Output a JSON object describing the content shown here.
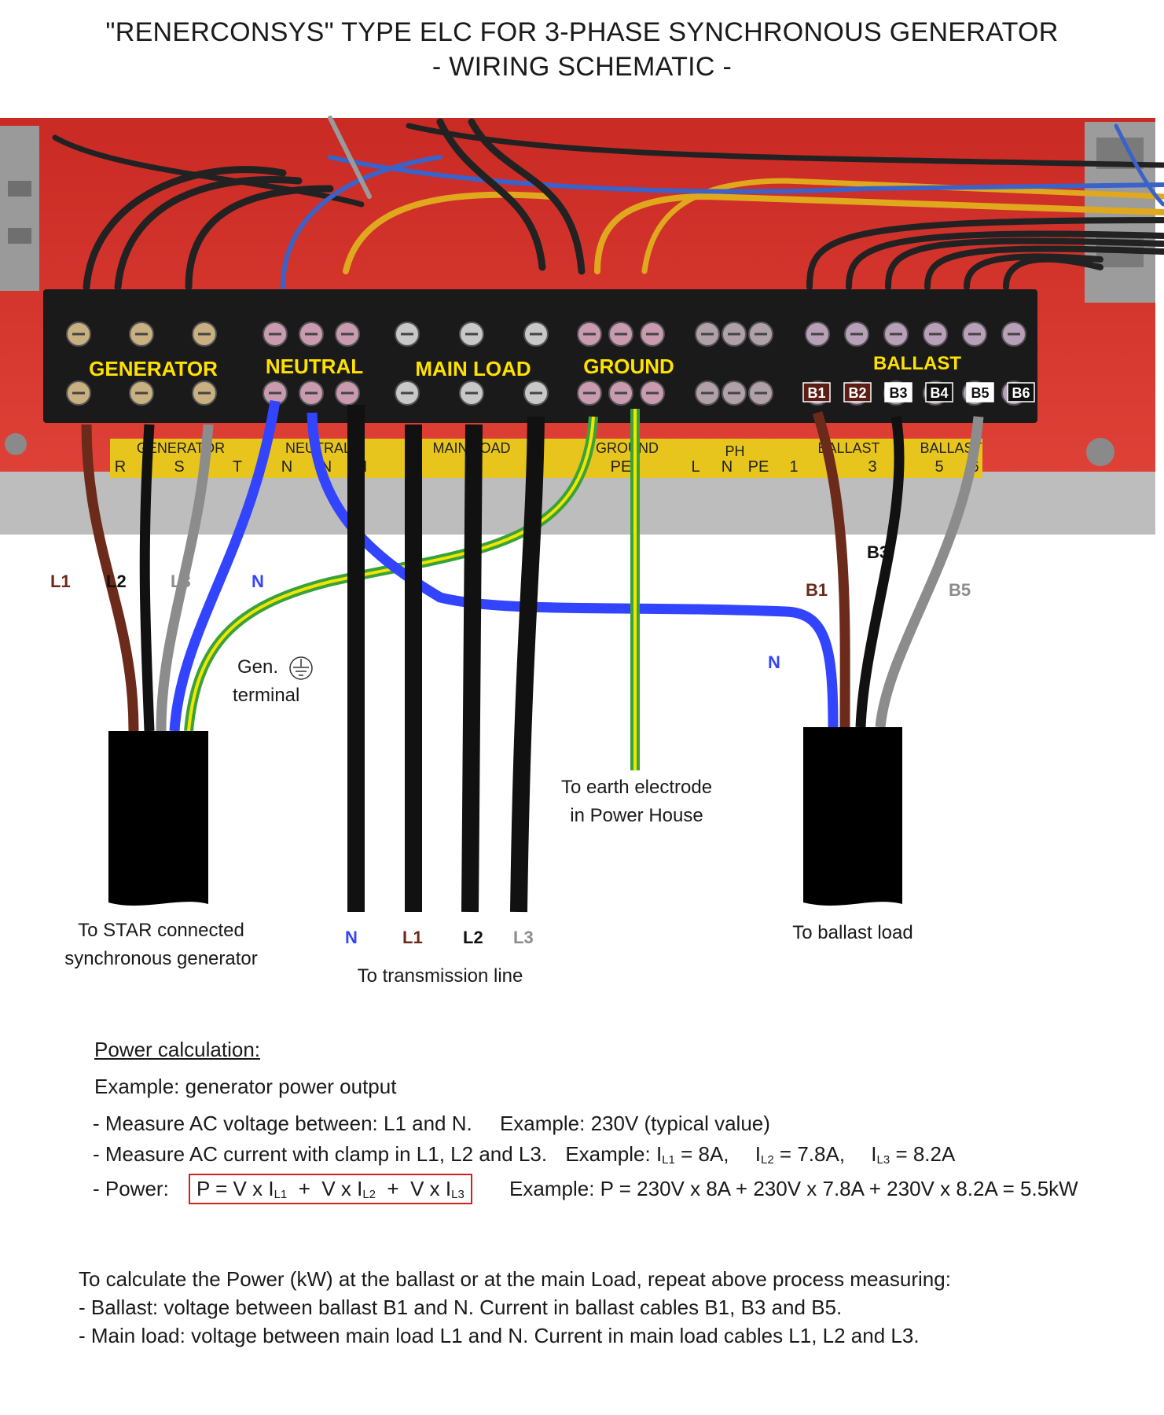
{
  "title": {
    "line1": "\"RENERCONSYS\" TYPE ELC FOR 3-PHASE SYNCHRONOUS GENERATOR",
    "line2": "- WIRING SCHEMATIC -"
  },
  "panel": {
    "sections": [
      "GENERATOR",
      "NEUTRAL",
      "MAIN LOAD",
      "GROUND",
      "BALLAST"
    ],
    "ballast_terminals": [
      "B1",
      "B2",
      "B3",
      "B4",
      "B5",
      "B6"
    ],
    "rail_labels": {
      "generator": "GENERATOR",
      "generator_terms": [
        "R",
        "S",
        "T"
      ],
      "neutral": "NEUTRAL",
      "neutral_terms": [
        "N",
        "N",
        "N"
      ],
      "main_load": "MAIN LOAD",
      "ground": "GROUND",
      "ground_term": "PE",
      "ph": "PH",
      "ph_terms": [
        "L",
        "N",
        "PE",
        "1"
      ],
      "ballast": "BALLAST",
      "ballast_terms": [
        "3",
        "5",
        "6"
      ]
    }
  },
  "wires": {
    "generator": [
      "L1",
      "L2",
      "L3",
      "N"
    ],
    "ballast": [
      "B1",
      "B3",
      "B5"
    ],
    "ballast_neutral": "N",
    "transmission": [
      "N",
      "L1",
      "L2",
      "L3"
    ]
  },
  "colors": {
    "brown": "#6b2a1a",
    "black": "#111111",
    "grey": "#8c8c8c",
    "blue": "#3344ff",
    "earth_green": "#3aa23a",
    "earth_yellow": "#f2e600",
    "panel_red": "#d8302a",
    "label_yellow": "#ffe100",
    "formula_box": "#d42020"
  },
  "labels": {
    "gen_terminal": [
      "Gen.",
      "terminal"
    ],
    "earth_electrode": [
      "To earth electrode",
      "in Power House"
    ],
    "generator_dest": [
      "To STAR connected",
      "synchronous generator"
    ],
    "transmission_dest": "To transmission line",
    "ballast_dest": "To ballast load"
  },
  "calculation": {
    "heading": "Power calculation:",
    "example_intro": "Example: generator power output",
    "voltage_line": "- Measure AC voltage between: L1 and N.",
    "voltage_example": "Example: 230V (typical value)",
    "current_line": "- Measure AC current with clamp in L1, L2 and L3.",
    "current_example_prefix": "Example:",
    "currents": [
      {
        "label": "I",
        "sub": "L1",
        "value": "= 8A,"
      },
      {
        "label": "I",
        "sub": "L2",
        "value": "= 7.8A,"
      },
      {
        "label": "I",
        "sub": "L3",
        "value": "= 8.2A"
      }
    ],
    "power_label": "- Power:",
    "formula": {
      "p": "P = V x I",
      "sub1": "L1",
      "plus2": "  +  V x I",
      "sub2": "L2",
      "plus3": "  +  V x I",
      "sub3": "L3"
    },
    "power_example": "Example:  P = 230V x 8A + 230V x 7.8A + 230V x 8.2A = 5.5kW",
    "repeat_intro": "To calculate the Power (kW) at the ballast or at the main Load, repeat above process measuring:",
    "ballast_line": "- Ballast:  voltage between ballast B1 and N. Current in ballast cables B1, B3 and B5.",
    "mainload_line": "- Main load: voltage between main load L1 and N. Current in main load cables L1, L2 and L3."
  }
}
